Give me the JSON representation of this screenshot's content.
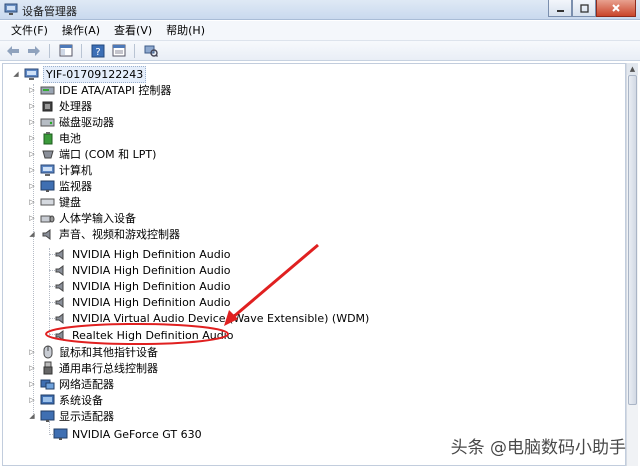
{
  "window": {
    "title": "设备管理器"
  },
  "menu": [
    "文件(F)",
    "操作(A)",
    "查看(V)",
    "帮助(H)"
  ],
  "tree": {
    "root": "YIF-01709122243",
    "categories": [
      {
        "label": "IDE ATA/ATAPI 控制器",
        "icon": "ide-controller-icon",
        "expanded": false
      },
      {
        "label": "处理器",
        "icon": "processor-icon",
        "expanded": false
      },
      {
        "label": "磁盘驱动器",
        "icon": "disk-drive-icon",
        "expanded": false
      },
      {
        "label": "电池",
        "icon": "battery-icon",
        "expanded": false
      },
      {
        "label": "端口 (COM 和 LPT)",
        "icon": "port-icon",
        "expanded": false
      },
      {
        "label": "计算机",
        "icon": "computer-icon",
        "expanded": false
      },
      {
        "label": "监视器",
        "icon": "monitor-icon",
        "expanded": false
      },
      {
        "label": "键盘",
        "icon": "keyboard-icon",
        "expanded": false
      },
      {
        "label": "人体学输入设备",
        "icon": "hid-icon",
        "expanded": false
      },
      {
        "label": "声音、视频和游戏控制器",
        "icon": "sound-icon",
        "expanded": true,
        "children": [
          "NVIDIA High Definition Audio",
          "NVIDIA High Definition Audio",
          "NVIDIA High Definition Audio",
          "NVIDIA High Definition Audio",
          "NVIDIA Virtual Audio Device (Wave Extensible) (WDM)",
          "Realtek High Definition Audio"
        ]
      },
      {
        "label": "鼠标和其他指针设备",
        "icon": "mouse-icon",
        "expanded": false
      },
      {
        "label": "通用串行总线控制器",
        "icon": "usb-icon",
        "expanded": false
      },
      {
        "label": "网络适配器",
        "icon": "network-icon",
        "expanded": false
      },
      {
        "label": "系统设备",
        "icon": "system-icon",
        "expanded": false
      },
      {
        "label": "显示适配器",
        "icon": "display-adapter-icon",
        "expanded": true,
        "children": [
          "NVIDIA GeForce GT 630"
        ]
      }
    ]
  },
  "watermark": "头条 @电脑数码小助手",
  "colors": {
    "highlight_circle": "#e02020",
    "arrow": "#e02020"
  }
}
